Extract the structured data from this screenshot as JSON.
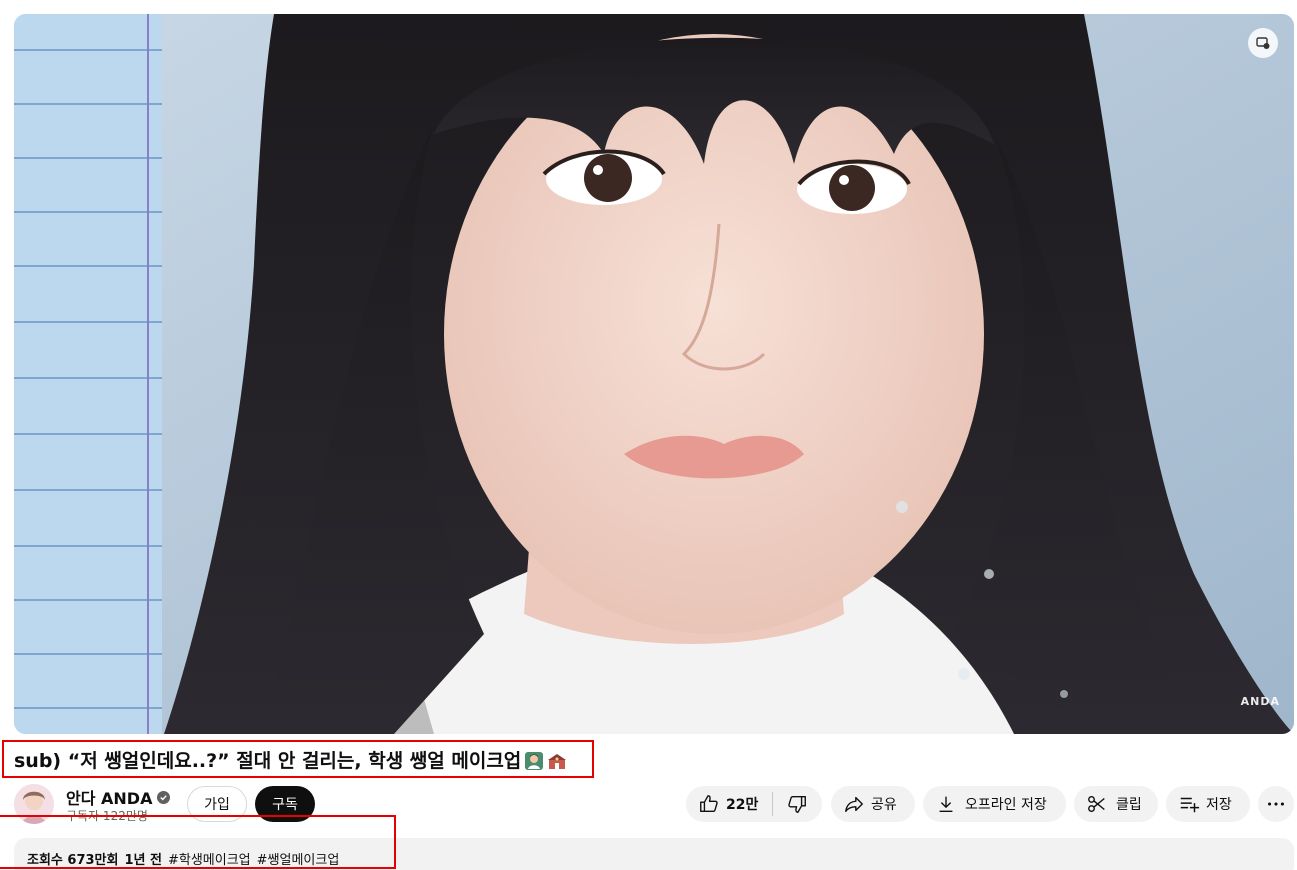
{
  "video": {
    "watermark": "ANDA",
    "cast_icon": "miniplayer-icon"
  },
  "title": {
    "text": "sub) “저 쌩얼인데요..?” 절대 안 걸리는, 학생 쌩얼 메이크업",
    "emojis": [
      "student-emoji",
      "school-emoji"
    ]
  },
  "channel": {
    "name": "안다 ANDA",
    "subscribers": "구독자 122만명",
    "join_label": "가입",
    "subscribe_label": "구독"
  },
  "actions": {
    "like_count": "22만",
    "share_label": "공유",
    "download_label": "오프라인 저장",
    "clip_label": "클립",
    "save_label": "저장"
  },
  "description": {
    "views": "조회수 673만회",
    "age": "1년 전",
    "tags": [
      "#학생메이크업",
      "#쌩얼메이크업"
    ]
  },
  "colors": {
    "highlight_red": "#e60000",
    "subscribe_bg": "#0f0f0f",
    "pill_bg": "#f2f2f2"
  }
}
